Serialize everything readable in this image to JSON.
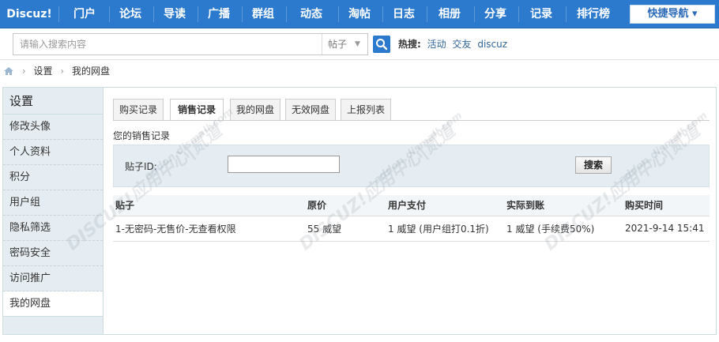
{
  "topnav": {
    "items": [
      "Discuz!",
      "门户",
      "论坛",
      "导读",
      "广播",
      "群组",
      "动态",
      "淘帖",
      "日志",
      "相册",
      "分享",
      "记录",
      "排行榜"
    ],
    "quick_nav": "快捷导航 ▾"
  },
  "search": {
    "placeholder": "请输入搜索内容",
    "type": "帖子",
    "hot_label": "热搜:",
    "hot_terms": [
      "活动",
      "交友",
      "discuz"
    ]
  },
  "breadcrumb": {
    "items": [
      "设置",
      "我的网盘"
    ]
  },
  "sidebar": {
    "title": "设置",
    "items": [
      "修改头像",
      "个人资料",
      "积分",
      "用户组",
      "隐私筛选",
      "密码安全",
      "访问推广",
      "我的网盘"
    ]
  },
  "tabs": [
    "购买记录",
    "销售记录",
    "我的网盘",
    "无效网盘",
    "上报列表"
  ],
  "main": {
    "subtitle": "您的销售记录",
    "filter_label": "贴子ID:",
    "search_button": "搜索"
  },
  "table": {
    "headers": [
      "贴子",
      "原价",
      "用户支付",
      "实际到账",
      "购买时间"
    ],
    "rows": [
      [
        "1-无密码-无售价-无查看权限",
        "55 威望",
        "1 威望 (用户组打0.1折)",
        "1 威望 (手续费50%)",
        "2021-9-14 15:41"
      ]
    ]
  },
  "watermark": {
    "text": "DISCUZ!应用中心|贰道",
    "url": "addon.dismall.com"
  },
  "colors": {
    "nav": "#2b7acd",
    "sidebar": "#e5edf2"
  }
}
